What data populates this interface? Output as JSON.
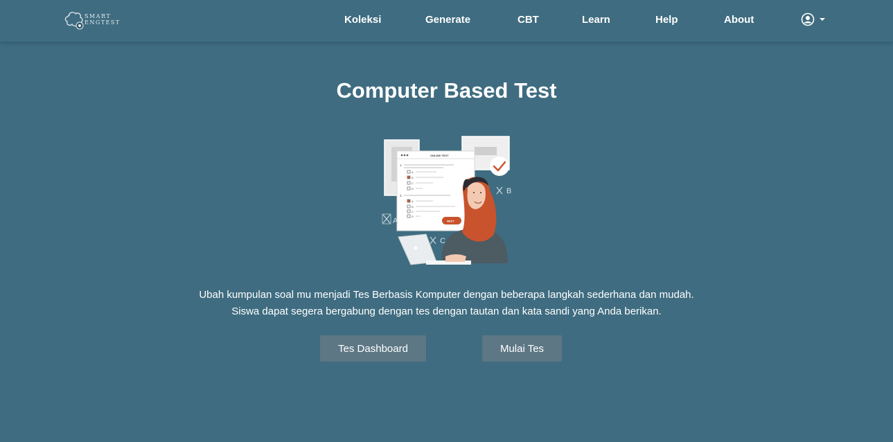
{
  "brand": {
    "line1": "SMART",
    "line2": "ENGTEST"
  },
  "nav": {
    "items": [
      "Koleksi",
      "Generate",
      "CBT",
      "Learn",
      "Help",
      "About"
    ]
  },
  "icons": {
    "user": "user-circle-icon",
    "caret": "caret-down-icon"
  },
  "main": {
    "title": "Computer Based Test",
    "description_line1": "Ubah kumpulan soal mu menjadi Tes Berbasis Komputer dengan beberapa langkah sederhana dan mudah.",
    "description_line2": "Siswa dapat segera bergabung dengan tes dengan tautan dan kata sandi yang Anda berikan.",
    "dashboard_button": "Tes Dashboard",
    "start_button": "Mulai Tes"
  },
  "illustration": {
    "sheet_header": "ONLINE TEST",
    "options_q1": [
      "A",
      "B",
      "C",
      "D"
    ],
    "options_q2": [
      "A",
      "B",
      "C",
      "D"
    ],
    "next_button": "NEXT",
    "floating_letters": [
      "A",
      "B",
      "C"
    ]
  },
  "colors": {
    "background": "#3f6c80",
    "button": "#5d7785",
    "accent": "#c8532c"
  }
}
